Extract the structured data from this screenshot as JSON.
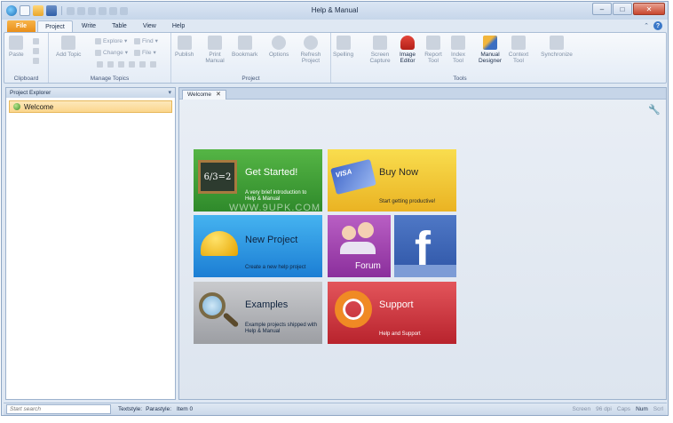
{
  "window": {
    "title": "Help & Manual"
  },
  "ribbon_tabs": [
    "File",
    "Project",
    "Write",
    "Table",
    "View",
    "Help"
  ],
  "ribbon": {
    "clipboard": {
      "label": "Clipboard",
      "paste": "Paste"
    },
    "manage_topics": {
      "label": "Manage Topics",
      "add_topic": "Add Topic",
      "explore": "Explore",
      "find": "Find",
      "change": "Change",
      "file": "File"
    },
    "project": {
      "label": "Project",
      "publish": "Publish",
      "print_manual": "Print Manual",
      "bookmark": "Bookmark",
      "options": "Options",
      "refresh_project": "Refresh Project"
    },
    "tools": {
      "label": "Tools",
      "spelling": "Spelling",
      "screen_capture": "Screen Capture",
      "image_editor": "Image Editor",
      "report_tool": "Report Tool",
      "index_tool": "Index Tool",
      "manual_designer": "Manual Designer",
      "context_tool": "Context Tool",
      "synchronize": "Synchronize"
    }
  },
  "explorer": {
    "header": "Project Explorer",
    "items": [
      {
        "label": "Welcome"
      }
    ]
  },
  "document": {
    "tab_label": "Welcome",
    "close_glyph": "✕"
  },
  "tiles": {
    "get_started": {
      "title": "Get Started!",
      "subtitle": "A very brief introduction to Help & Manual",
      "board_text": "6/3=2"
    },
    "buy_now": {
      "title": "Buy Now",
      "subtitle": "Start getting productive!",
      "card_text": "VISA"
    },
    "new_project": {
      "title": "New Project",
      "subtitle": "Create a new help project"
    },
    "forum": {
      "title": "Forum"
    },
    "facebook": {
      "glyph": "f"
    },
    "examples": {
      "title": "Examples",
      "subtitle": "Example projects shipped with Help & Manual"
    },
    "support": {
      "title": "Support",
      "subtitle": "Help and Support"
    },
    "watermark": "WWW.9UPK.COM"
  },
  "statusbar": {
    "search_placeholder": "Start search",
    "textstyle": "Textstyle:",
    "parastyle": "Parastyle:",
    "item": "Item 0",
    "screen": "Screen",
    "dpi": "96 dpi",
    "caps": "Caps",
    "num": "Num",
    "scrl": "Scrl"
  }
}
